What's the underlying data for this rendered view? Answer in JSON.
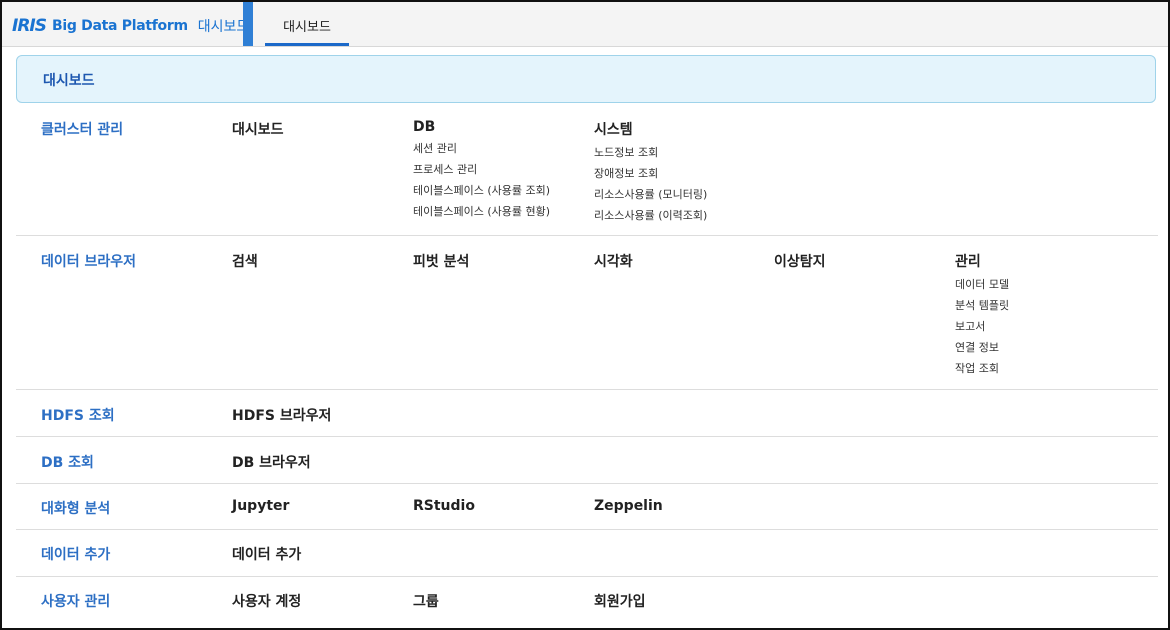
{
  "brand": {
    "iris": "IRIS",
    "platform": "Big Data Platform",
    "page": "대시보드"
  },
  "tab": {
    "label": "대시보드"
  },
  "panel": {
    "title": "대시보드"
  },
  "rows": [
    {
      "category": "클러스터 관리",
      "cols": [
        {
          "head": "대시보드",
          "items": []
        },
        {
          "head": "DB",
          "items": [
            "세션 관리",
            "프로세스 관리",
            "테이블스페이스 (사용률 조회)",
            "테이블스페이스 (사용률 현황)"
          ]
        },
        {
          "head": "시스템",
          "items": [
            "노드정보 조회",
            "장애정보 조회",
            "리소스사용률 (모니터링)",
            "리소스사용률 (이력조회)"
          ]
        }
      ]
    },
    {
      "category": "데이터 브라우저",
      "cols": [
        {
          "head": "검색",
          "items": []
        },
        {
          "head": "피벗 분석",
          "items": []
        },
        {
          "head": "시각화",
          "items": []
        },
        {
          "head": "이상탐지",
          "items": []
        },
        {
          "head": "관리",
          "items": [
            "데이터 모델",
            "분석 템플릿",
            "보고서",
            "연결 정보",
            "작업 조회"
          ]
        }
      ]
    },
    {
      "category": "HDFS 조회",
      "cols": [
        {
          "head": "HDFS 브라우저",
          "items": []
        }
      ]
    },
    {
      "category": "DB 조회",
      "cols": [
        {
          "head": "DB 브라우저",
          "items": []
        }
      ]
    },
    {
      "category": "대화형 분석",
      "cols": [
        {
          "head": "Jupyter",
          "items": []
        },
        {
          "head": "RStudio",
          "items": []
        },
        {
          "head": "Zeppelin",
          "items": []
        }
      ]
    },
    {
      "category": "데이터 추가",
      "cols": [
        {
          "head": "데이터 추가",
          "items": []
        }
      ]
    },
    {
      "category": "사용자 관리",
      "cols": [
        {
          "head": "사용자 계정",
          "items": []
        },
        {
          "head": "그룹",
          "items": []
        },
        {
          "head": "회원가입",
          "items": []
        }
      ]
    }
  ],
  "colors": {
    "brand": "#1a73d1",
    "category": "#2d6fc4",
    "accent": "#2f7fd5",
    "panel_bg": "#e4f4fc",
    "panel_border": "#9fd3ea"
  }
}
